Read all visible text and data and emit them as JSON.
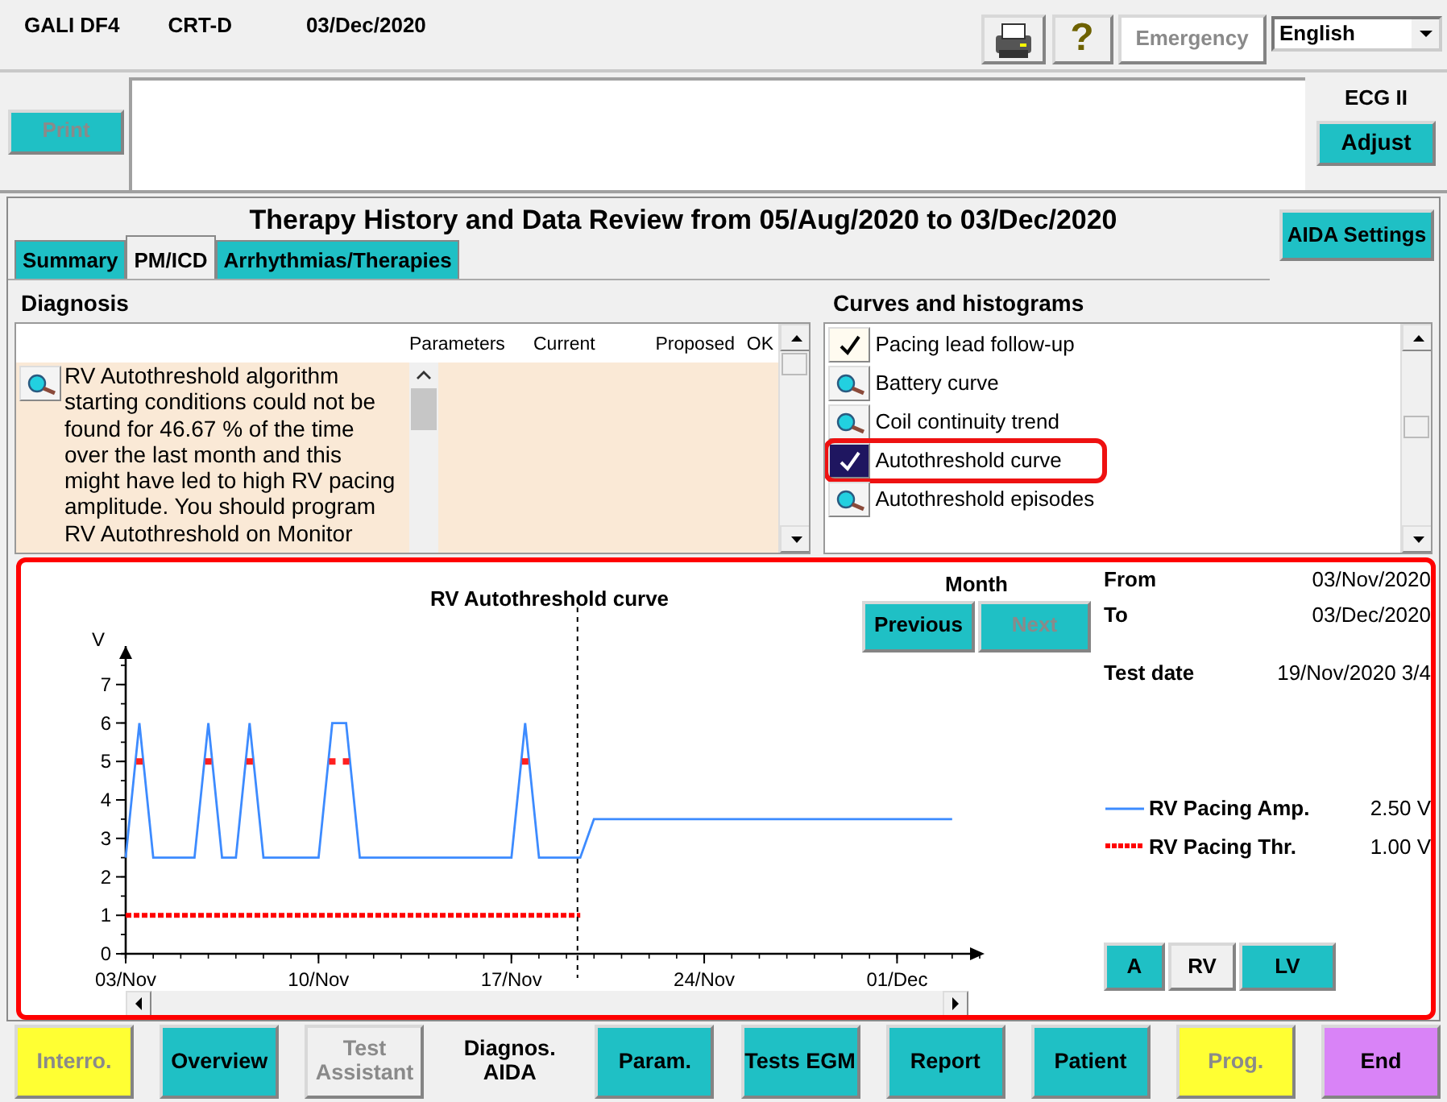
{
  "header": {
    "device": "GALI DF4",
    "type": "CRT-D",
    "date": "03/Dec/2020"
  },
  "toolbar": {
    "help_button": "?",
    "emergency": {
      "label": "Emergency",
      "disabled": true
    },
    "language": "English"
  },
  "print_button": {
    "label": "Print",
    "disabled": true
  },
  "ecg": {
    "label": "ECG II",
    "button": "Adjust"
  },
  "title": "Therapy History and Data Review from 05/Aug/2020 to 03/Dec/2020",
  "aida_settings": "AIDA Settings",
  "tabs": [
    {
      "label": "Summary",
      "selected": false
    },
    {
      "label": "PM/ICD",
      "selected": true
    },
    {
      "label": "Arrhythmias/Therapies",
      "selected": false
    }
  ],
  "diagnosis": {
    "title": "Diagnosis",
    "columns": [
      "Parameters",
      "Current",
      "Proposed",
      "OK"
    ],
    "message": "RV Autothreshold algorithm starting conditions could not be found for 46.67 % of the time over the last month and this might have led to high RV pacing amplitude. You should program RV Autothreshold on Monitor"
  },
  "curves": {
    "title": "Curves and histograms",
    "items": [
      {
        "label": "Pacing lead follow-up",
        "kind": "check",
        "selected": false
      },
      {
        "label": "Battery curve",
        "kind": "view",
        "selected": false
      },
      {
        "label": "Coil continuity trend",
        "kind": "view",
        "selected": false
      },
      {
        "label": "Autothreshold curve",
        "kind": "check",
        "selected": true
      },
      {
        "label": "Autothreshold episodes",
        "kind": "view",
        "selected": false
      }
    ]
  },
  "chart_panel": {
    "month_label": "Month",
    "nav": [
      {
        "label": "Previous",
        "disabled": false
      },
      {
        "label": "Next",
        "disabled": true
      }
    ],
    "info": [
      {
        "label": "From",
        "value": "03/Nov/2020"
      },
      {
        "label": "To",
        "value": "03/Dec/2020"
      },
      {
        "label": "Test date",
        "value": "19/Nov/2020 3/4"
      }
    ],
    "readings": [
      "2.50 V",
      "1.00 V"
    ],
    "chambers": [
      {
        "label": "A",
        "selected": false
      },
      {
        "label": "RV",
        "selected": true
      },
      {
        "label": "LV",
        "selected": false
      }
    ],
    "chart_data": {
      "type": "line",
      "title": "RV Autothreshold curve",
      "ylabel": "V",
      "categories": [
        "03/Nov",
        null,
        null,
        null,
        null,
        null,
        null,
        null,
        null,
        null,
        null,
        null,
        null,
        null,
        "10/Nov",
        null,
        null,
        null,
        null,
        null,
        null,
        null,
        null,
        null,
        null,
        null,
        null,
        null,
        "17/Nov",
        null,
        null,
        null,
        null,
        null,
        null,
        null,
        null,
        null,
        null,
        null,
        null,
        null,
        "24/Nov",
        null,
        null,
        null,
        null,
        null,
        null,
        null,
        null,
        null,
        null,
        null,
        null,
        null,
        "01/Dec",
        null,
        null,
        null,
        null
      ],
      "series": [
        {
          "name": "RV Pacing Amp.",
          "color": "#3d8bff",
          "values": [
            2.5,
            6,
            2.5,
            2.5,
            2.5,
            2.5,
            6,
            2.5,
            2.5,
            6,
            2.5,
            2.5,
            2.5,
            2.5,
            2.5,
            6,
            6,
            2.5,
            2.5,
            2.5,
            2.5,
            2.5,
            2.5,
            2.5,
            2.5,
            2.5,
            2.5,
            2.5,
            2.5,
            6,
            2.5,
            2.5,
            2.5,
            2.5,
            3.5,
            3.5,
            3.5,
            3.5,
            3.5,
            3.5,
            3.5,
            3.5,
            3.5,
            3.5,
            3.5,
            3.5,
            3.5,
            3.5,
            3.5,
            3.5,
            3.5,
            3.5,
            3.5,
            3.5,
            3.5,
            3.5,
            3.5,
            3.5,
            3.5,
            3.5,
            3.5
          ]
        },
        {
          "name": "RV Pacing Thr.",
          "color": "#ff0000",
          "line_style": "dotted",
          "values": [
            1,
            1,
            1,
            1,
            1,
            1,
            1,
            1,
            1,
            1,
            1,
            1,
            1,
            1,
            1,
            1,
            1,
            1,
            1,
            1,
            1,
            1,
            1,
            1,
            1,
            1,
            1,
            1,
            1,
            1,
            1,
            1,
            1,
            1,
            null,
            null,
            null,
            null,
            null,
            null,
            null,
            null,
            null,
            null,
            null,
            null,
            null,
            null,
            null,
            null,
            null,
            null,
            null,
            null,
            null,
            null,
            null,
            null,
            null,
            null,
            null
          ]
        }
      ],
      "ylim": [
        0,
        8
      ],
      "yticks": [
        0,
        1,
        2,
        3,
        4,
        5,
        6,
        7
      ]
    }
  },
  "bottom_buttons": [
    {
      "label": "Interro.",
      "color": "#ffff33",
      "disabled": true,
      "selected": false
    },
    {
      "label": "Overview",
      "color": "#1fc0c5",
      "disabled": false,
      "selected": false
    },
    {
      "label": "Test Assistant",
      "color": "#f0f0f0",
      "disabled": true,
      "selected": false
    },
    {
      "label": "Diagnos. AIDA",
      "color": "#f0f0f0",
      "disabled": false,
      "selected": true
    },
    {
      "label": "Param.",
      "color": "#1fc0c5",
      "disabled": false,
      "selected": false
    },
    {
      "label": "Tests EGM",
      "color": "#1fc0c5",
      "disabled": false,
      "selected": false
    },
    {
      "label": "Report",
      "color": "#1fc0c5",
      "disabled": false,
      "selected": false
    },
    {
      "label": "Patient",
      "color": "#1fc0c5",
      "disabled": false,
      "selected": false
    },
    {
      "label": "Prog.",
      "color": "#ffff33",
      "disabled": true,
      "selected": false
    },
    {
      "label": "End",
      "color": "#d983f7",
      "disabled": false,
      "selected": false
    }
  ]
}
